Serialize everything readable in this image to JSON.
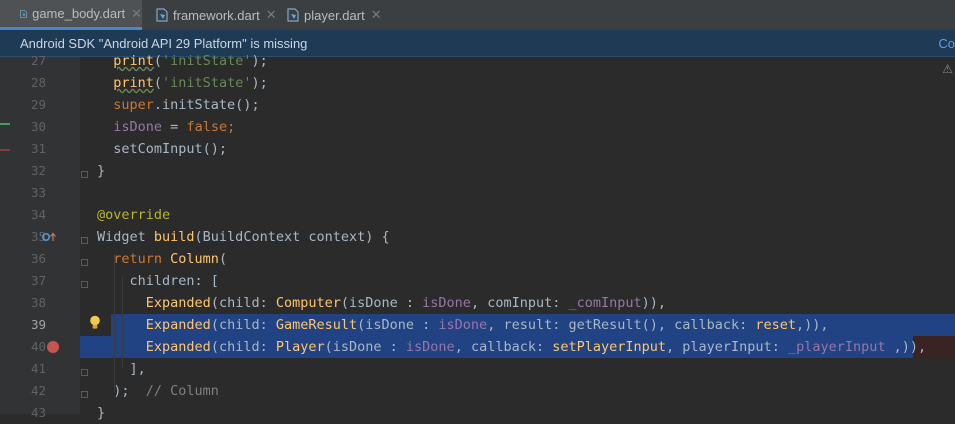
{
  "tabs": [
    {
      "label": "game_body.dart",
      "active": true
    },
    {
      "label": "framework.dart",
      "active": false
    },
    {
      "label": "player.dart",
      "active": false
    }
  ],
  "tab_close_glyph": "✕",
  "banner": {
    "message": "Android SDK \"Android API 29 Platform\" is missing",
    "link": "Co"
  },
  "line_numbers": [
    "27",
    "28",
    "29",
    "30",
    "31",
    "32",
    "33",
    "34",
    "35",
    "36",
    "37",
    "38",
    "39",
    "40",
    "41",
    "42",
    "43"
  ],
  "current_line": "39",
  "code": {
    "l27": {
      "indent": "  ",
      "fn": "print",
      "open": "(",
      "str": "'initState'",
      "close": ");"
    },
    "l28": {
      "indent": "  ",
      "fn": "print",
      "open": "(",
      "str": "'initState'",
      "close": ");"
    },
    "l29": {
      "indent": "  ",
      "kw": "super",
      "rest": ".initState();"
    },
    "l30": {
      "indent": "  ",
      "pr": "isDone",
      "op": " = ",
      "kw": "false",
      "semi": ";"
    },
    "l31": {
      "indent": "  ",
      "text": "setComInput();"
    },
    "l32": {
      "text": "}"
    },
    "l33": {
      "text": ""
    },
    "l34": {
      "an": "@override"
    },
    "l35": {
      "a": "Widget ",
      "fn": "build",
      "b": "(BuildContext context) {"
    },
    "l36": {
      "indent": "  ",
      "kw": "return ",
      "fn": "Column",
      "b": "("
    },
    "l37": {
      "indent": "    ",
      "text": "children: ["
    },
    "l38": {
      "indent": "      ",
      "f1": "Expanded",
      "a": "(child: ",
      "f2": "Computer",
      "b": "(isDone : ",
      "p1": "isDone",
      "c": ", comInput: ",
      "p2": "_comInput",
      "d": ")),"
    },
    "l39": {
      "indent": "      ",
      "f1": "Expanded",
      "a": "(child: ",
      "f2": "GameResult",
      "b": "(isDone : ",
      "p1": "isDone",
      "c": ", result: getResult(), callback: ",
      "f3": "reset",
      "d": ",)),"
    },
    "l40": {
      "indent": "      ",
      "f1": "Expanded",
      "a": "(child: ",
      "f2": "Player",
      "b": "(isDone : ",
      "p1": "isDone",
      "c": ", callback: ",
      "f3": "setPlayerInput",
      "e": ", playerInput: ",
      "p2": "_playerInput",
      "d": " ,)),"
    },
    "l41": {
      "indent": "    ",
      "text": "],"
    },
    "l42": {
      "indent": "  ",
      "text": ");  ",
      "cm": "// Column"
    },
    "l43": {
      "text": "}"
    }
  },
  "colors": {
    "background": "#2b2b2b",
    "selection": "#214283",
    "keyword": "#cc7832",
    "function": "#ffc66d",
    "string": "#6a8759",
    "property": "#9876aa"
  },
  "icons": [
    "dart-file-icon",
    "override-marker-icon",
    "intention-bulb-icon",
    "breakpoint-icon",
    "warning-triangle-icon"
  ]
}
